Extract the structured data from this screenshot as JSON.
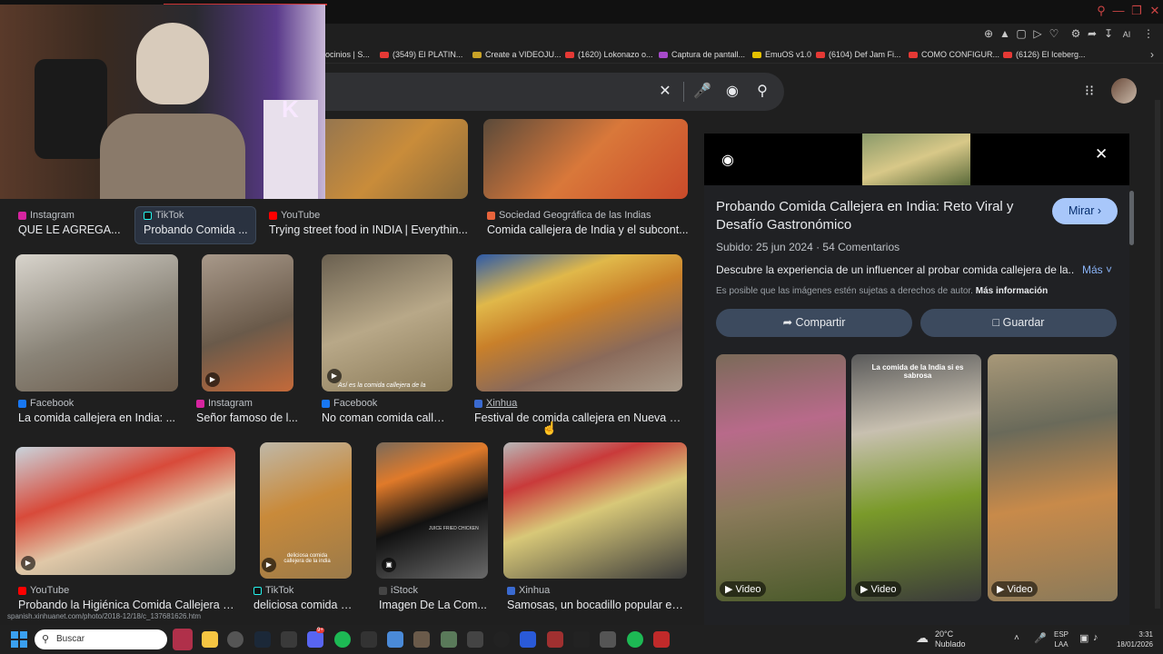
{
  "bookmarks": [
    "ocinios | S...",
    "(3549) El PLATIN...",
    "Create a VIDEOJU...",
    "(1620) Lokonazo o...",
    "Captura de pantall...",
    "EmuOS v1.0",
    "(6104) Def Jam Fi...",
    "COMO CONFIGUR...",
    "(6126) El Iceberg..."
  ],
  "toolbar_ai": "AI",
  "results": [
    {
      "source": "Instagram",
      "title": "QUE LE AGREGA..."
    },
    {
      "source": "TikTok",
      "title": "Probando Comida ..."
    },
    {
      "source": "YouTube",
      "title": "Trying street food in INDIA | Everythin..."
    },
    {
      "source": "Sociedad Geográfica de las Indias",
      "title": "Comida callejera de India y el subcont..."
    },
    {
      "source": "Facebook",
      "title": "La comida callejera en India: ..."
    },
    {
      "source": "Instagram",
      "title": "Señor famoso de l..."
    },
    {
      "source": "Facebook",
      "title": "No coman comida callej..."
    },
    {
      "source": "Xinhua",
      "title": "Festival de comida callejera en Nueva D..."
    },
    {
      "source": "YouTube",
      "title": "Probando la Higiénica Comida Callejera d..."
    },
    {
      "source": "TikTok",
      "title": "deliciosa comida c..."
    },
    {
      "source": "iStock",
      "title": "Imagen De La Com..."
    },
    {
      "source": "Xinhua",
      "title": "Samosas, un bocadillo popular en..."
    }
  ],
  "overlays": {
    "r2c3": "Así es la comida callejera de la",
    "r3c2": "deliciosa comida callejera de la india",
    "r3c3": "JUICE FRIED CHICKEN"
  },
  "status_url": "spanish.xinhuanet.com/photo/2018-12/18/c_137681626.htm",
  "panel": {
    "title": "Probando Comida Callejera en India: Reto Viral y Desafío Gastronómico",
    "watch_label": "Mirar",
    "meta": "Subido: 25 jun 2024 · 54 Comentarios",
    "description": "Descubre la experiencia de un influencer al probar comida callejera de la...",
    "more_label": "Más",
    "copyright": "Es posible que las imágenes estén sujetas a derechos de autor.",
    "more_info": "Más información",
    "share_label": "Compartir",
    "save_label": "Guardar",
    "video_label": "Video",
    "related_caption": "La comida de la India si es sabrosa"
  },
  "taskbar": {
    "search_placeholder": "Buscar",
    "temp": "20°C",
    "weather": "Nublado",
    "lang": "ESP",
    "lang2": "LAA",
    "time": "3:31",
    "date": "18/01/2026",
    "discord_badge": "9+"
  },
  "colors": {
    "accent": "#8ab4f8",
    "pill": "#a8c7fa",
    "button_bg": "#3c4a5e",
    "panel_bg": "#202124",
    "page_bg": "#1f1f1f"
  }
}
